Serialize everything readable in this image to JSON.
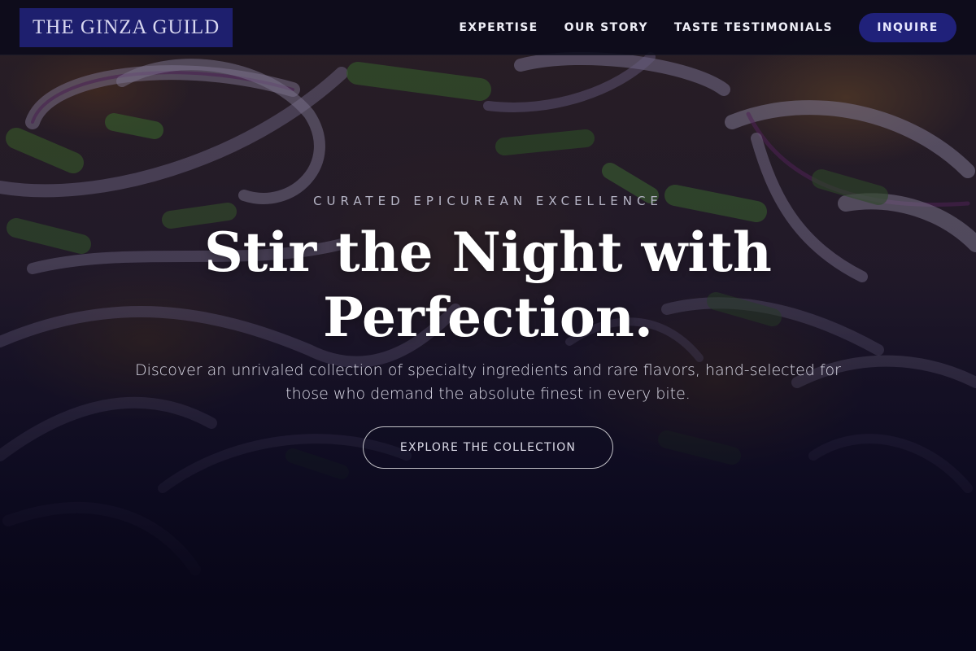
{
  "header": {
    "logo_text": "THE GINZA GUILD",
    "nav": [
      {
        "label": "EXPERTISE"
      },
      {
        "label": "OUR STORY"
      },
      {
        "label": "TASTE TESTIMONIALS"
      }
    ],
    "cta_label": "INQUIRE"
  },
  "hero": {
    "eyebrow": "CURATED EPICUREAN EXCELLENCE",
    "headline_line1": "Stir the Night with",
    "headline_line2": "Perfection.",
    "subtext": "Discover an unrivaled collection of specialty ingredients and rare flavors, hand-selected for those who demand the absolute finest in every bite.",
    "button_label": "EXPLORE THE COLLECTION"
  },
  "colors": {
    "accent": "#1e1f6e",
    "button": "#20217a",
    "background_dark": "#07061a"
  }
}
